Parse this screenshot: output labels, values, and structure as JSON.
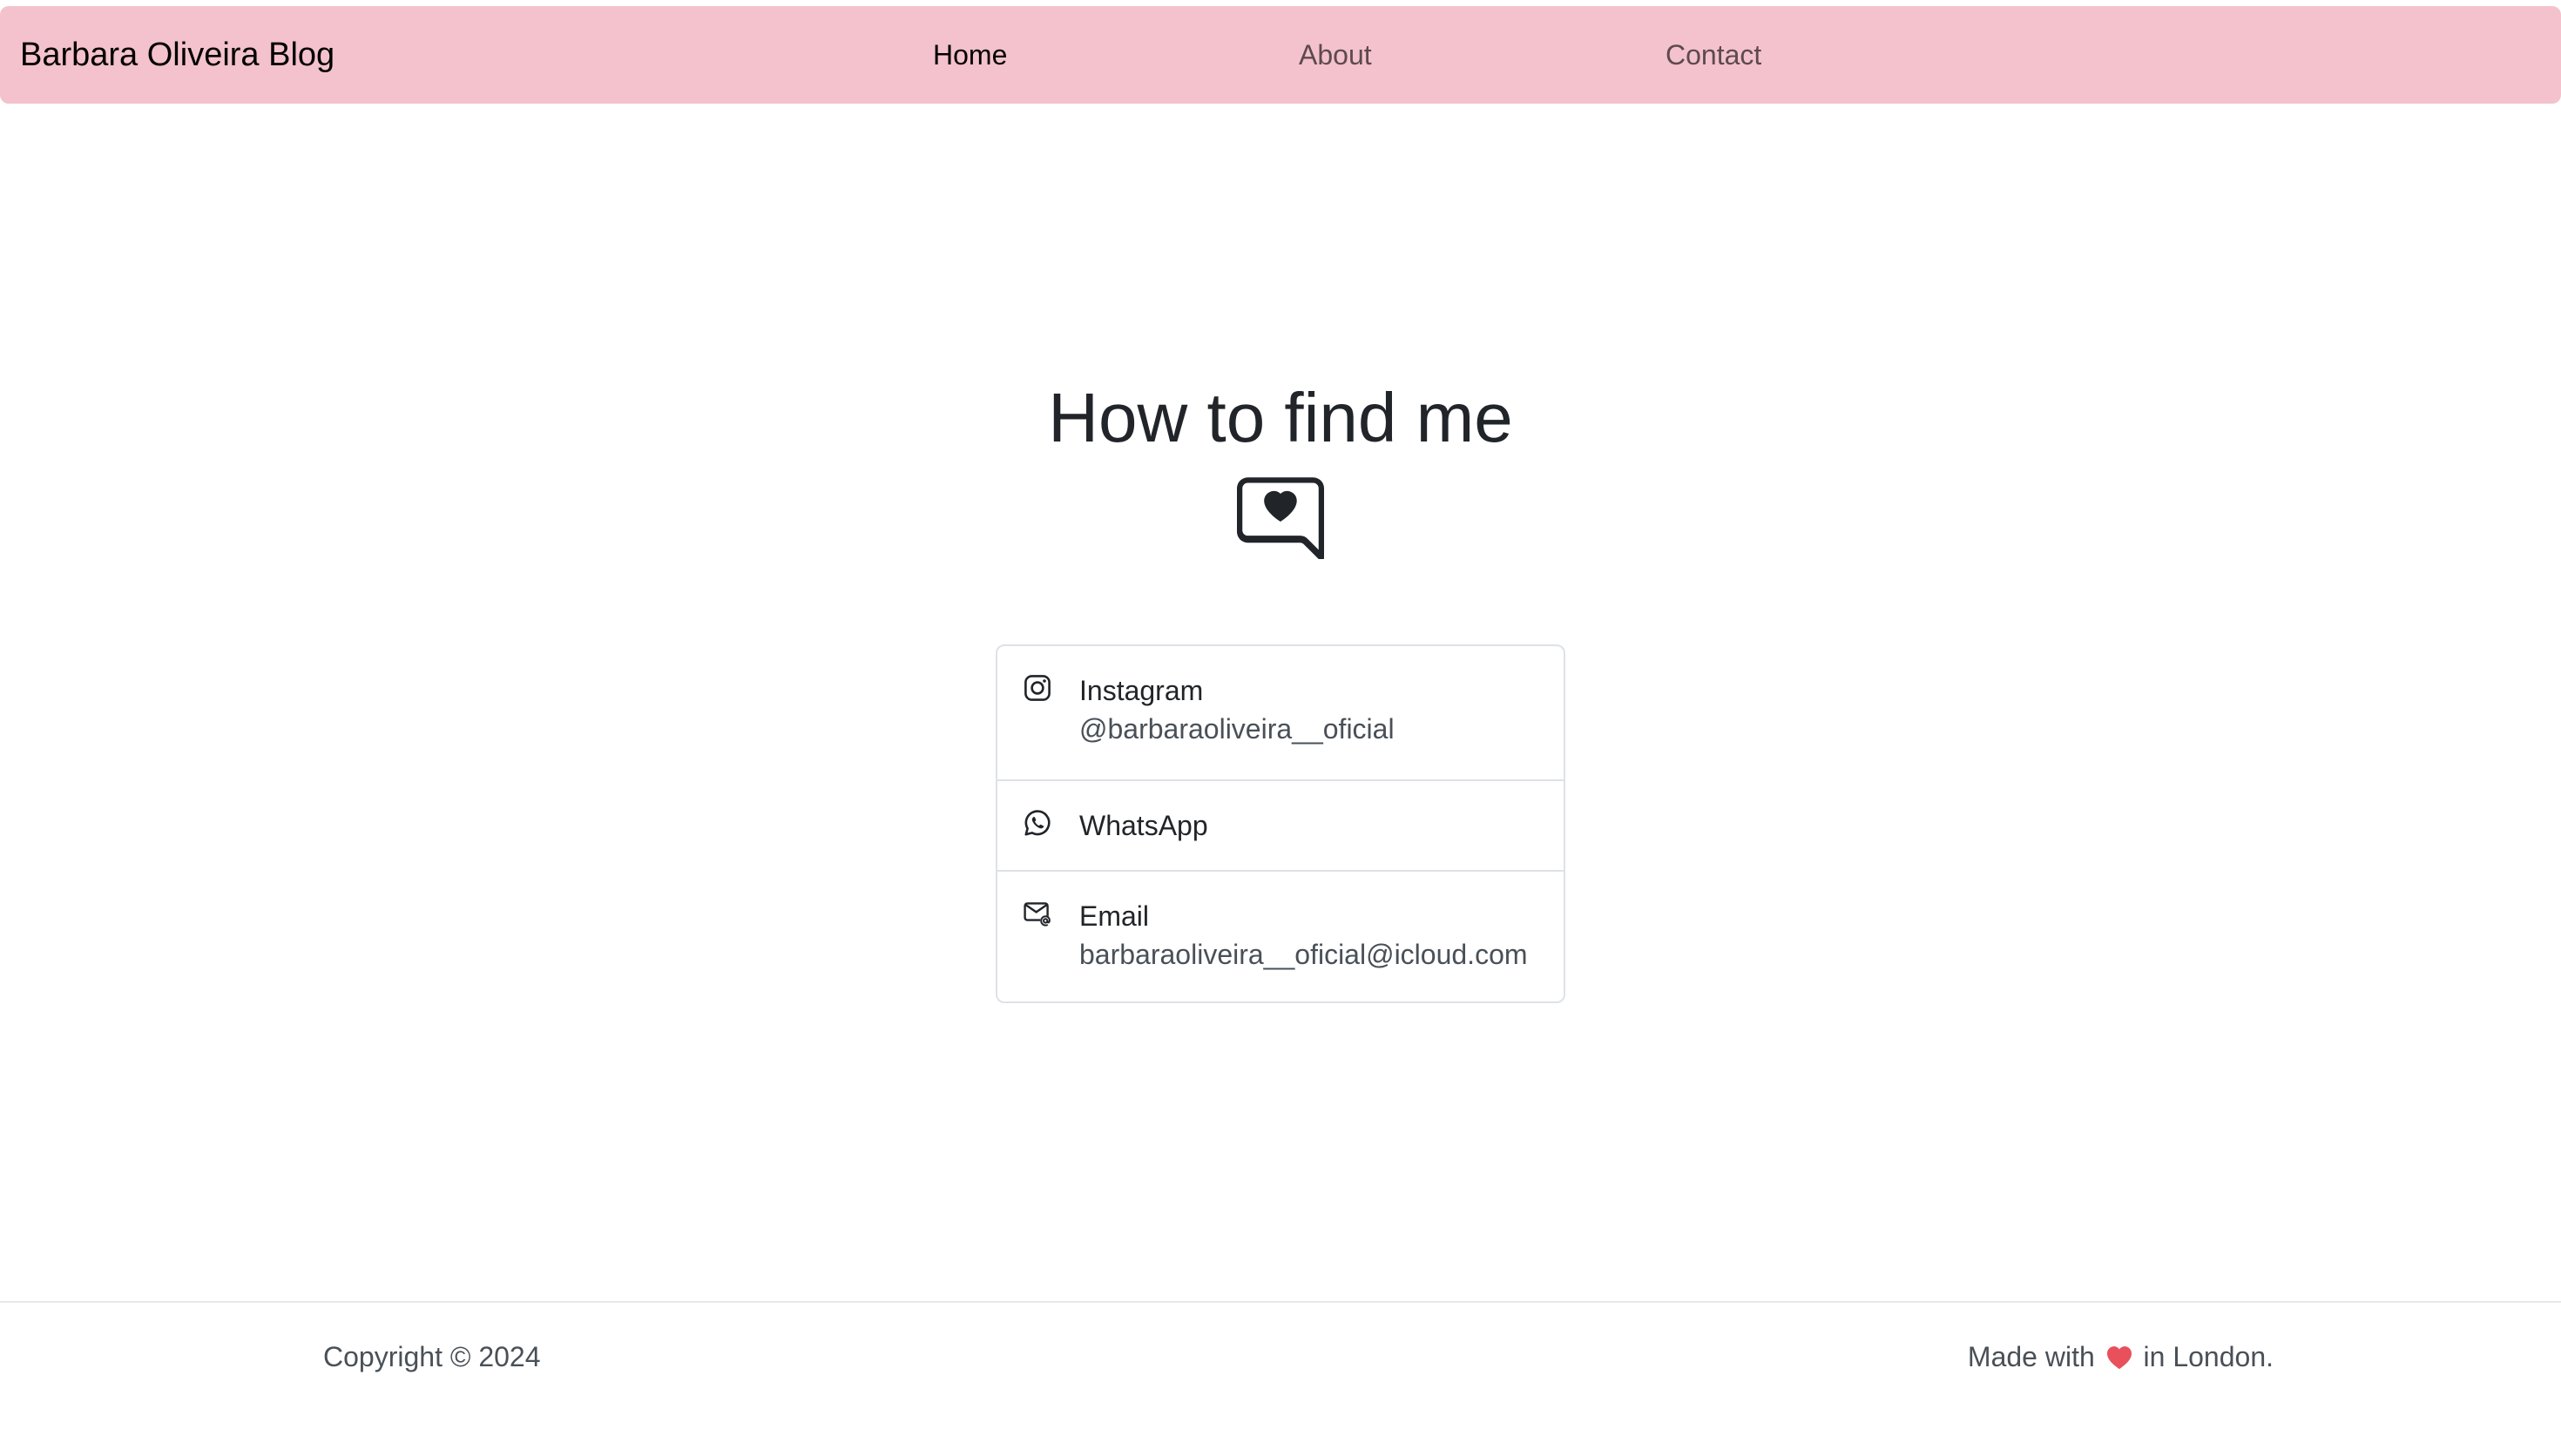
{
  "navbar": {
    "brand": "Barbara Oliveira Blog",
    "links": [
      {
        "label": "Home",
        "active": true
      },
      {
        "label": "About",
        "active": false
      },
      {
        "label": "Contact",
        "active": false
      }
    ],
    "background": "#f4c2cc"
  },
  "main": {
    "heading": "How to find me",
    "heading_icon": "chat-heart-icon",
    "contacts": [
      {
        "icon": "instagram-icon",
        "title": "Instagram",
        "subtitle": "@barbaraoliveira__oficial"
      },
      {
        "icon": "whatsapp-icon",
        "title": "WhatsApp",
        "subtitle": ""
      },
      {
        "icon": "envelope-at-icon",
        "title": "Email",
        "subtitle": "barbaraoliveira__oficial@icloud.com"
      }
    ]
  },
  "footer": {
    "copyright": "Copyright © 2024",
    "made_with_prefix": "Made with",
    "made_with_icon": "red-heart-icon",
    "made_with_suffix": "in London.",
    "heart_color": "#e8505b"
  }
}
